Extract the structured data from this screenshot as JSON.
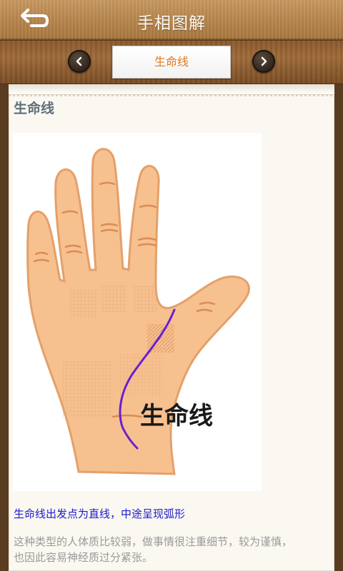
{
  "header": {
    "title": "手相图解",
    "back_icon": "back-arrow-icon"
  },
  "nav": {
    "current_tab": "生命线",
    "prev_icon": "chevron-left-icon",
    "next_icon": "chevron-right-icon",
    "accent_color": "#e07a1a"
  },
  "content": {
    "section_title": "生命线",
    "image_label": "生命线",
    "caption": "生命线出发点为直线，中途呈现弧形",
    "body_lines": [
      "这种类型的人体质比较弱，做事情很注重细节，较为谨慎，",
      "也因此容易神经质过分紧张。"
    ],
    "caption_color": "#1b1bcc",
    "life_line_color": "#6a1fd0"
  }
}
